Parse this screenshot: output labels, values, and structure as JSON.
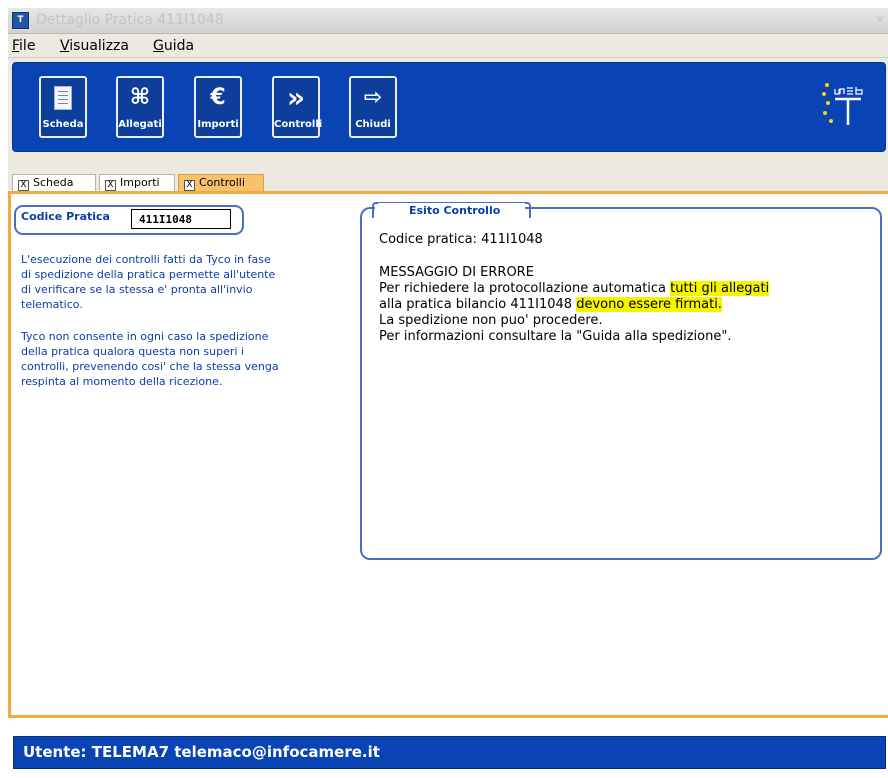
{
  "window": {
    "title": "Dettaglio Pratica 411I1048",
    "app_icon_text": "T",
    "close_glyph": "✕"
  },
  "menu": {
    "items": [
      "File",
      "Visualizza",
      "Guida"
    ]
  },
  "toolbar": {
    "buttons": [
      {
        "label": "Scheda",
        "icon": "document-icon"
      },
      {
        "label": "Allegati",
        "icon": "attachments-icon",
        "glyph": "⌘"
      },
      {
        "label": "Importi",
        "icon": "euro-icon",
        "glyph": "€"
      },
      {
        "label": "Controlli",
        "icon": "fast-forward-icon",
        "glyph": "»"
      },
      {
        "label": "Chiudi",
        "icon": "exit-icon",
        "glyph": "⇨"
      }
    ],
    "logo_text": "web T"
  },
  "tabs": [
    {
      "label": "Scheda",
      "active": false
    },
    {
      "label": "Importi",
      "active": false
    },
    {
      "label": "Controlli",
      "active": true
    }
  ],
  "tab_checkbox_glyph": "X",
  "codice": {
    "label": "Codice Pratica",
    "value": "411I1048"
  },
  "info": {
    "paragraph1": [
      "L'esecuzione dei controlli fatti da Tyco in  fase",
      "di spedizione della pratica permette all'utente",
      "di verificare se la stessa e' pronta all'invio",
      "telematico."
    ],
    "paragraph2": [
      "Tyco non consente in ogni caso la spedizione",
      "della pratica qualora questa non superi i",
      "controlli, prevenendo cosi' che la stessa venga",
      "respinta al momento della ricezione."
    ]
  },
  "esito": {
    "title": "Esito Controllo",
    "codice_line": "Codice pratica: 411I1048",
    "error_heading": "MESSAGGIO DI ERRORE",
    "line1_prefix": "Per richiedere la protocollazione automatica ",
    "line1_highlight": "tutti gli allegati",
    "line2_prefix": "alla pratica bilancio 411I1048 ",
    "line2_highlight": "devono essere firmati.",
    "line3": "La spedizione non puo' procedere.",
    "line4": "Per informazioni consultare la \"Guida alla spedizione\"."
  },
  "status": {
    "text": "Utente: TELEMA7   telemaco@infocamere.it"
  },
  "colors": {
    "toolbar_blue": "#0a44b4",
    "accent_orange": "#f2a93f",
    "text_blue": "#0a3da8",
    "highlight_yellow": "#f6f500"
  }
}
